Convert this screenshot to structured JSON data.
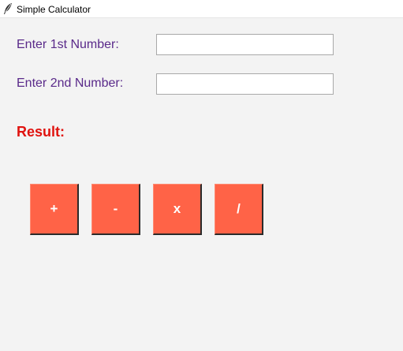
{
  "window": {
    "title": "Simple Calculator",
    "icon": "feather-icon"
  },
  "form": {
    "first_label": "Enter 1st Number:",
    "first_value": "",
    "second_label": "Enter 2nd Number:",
    "second_value": "",
    "result_label": "Result:"
  },
  "buttons": {
    "add": "+",
    "subtract": "-",
    "multiply": "x",
    "divide": "/"
  },
  "colors": {
    "background": "#f3f3f3",
    "label": "#5a2a8a",
    "result": "#e0130f",
    "button": "#ff6347",
    "button_text": "#ffffff"
  }
}
